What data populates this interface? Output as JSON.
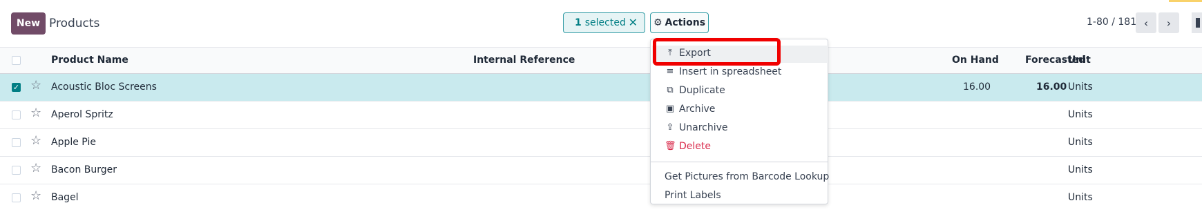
{
  "control_panel": {
    "new_label": "New",
    "title": "Products",
    "selected_count": "1",
    "selected_label": "selected",
    "clear_icon": "close-icon",
    "actions_label": "Actions",
    "actions_icon": "gear-icon",
    "pager_text": "1-80 / 181",
    "prev_icon": "chevron-left-icon",
    "next_icon": "chevron-right-icon"
  },
  "table": {
    "headers": {
      "name": "Product Name",
      "ref": "Internal Reference",
      "on_hand": "On Hand",
      "forecasted": "Forecasted",
      "unit": "Unit"
    },
    "rows": [
      {
        "name": "Acoustic Bloc Screens",
        "on_hand": "16.00",
        "forecasted": "16.00",
        "unit": "Units",
        "selected": true
      },
      {
        "name": "Aperol Spritz",
        "on_hand": "",
        "forecasted": "",
        "unit": "Units",
        "selected": false
      },
      {
        "name": "Apple Pie",
        "on_hand": "",
        "forecasted": "",
        "unit": "Units",
        "selected": false
      },
      {
        "name": "Bacon Burger",
        "on_hand": "",
        "forecasted": "",
        "unit": "Units",
        "selected": false
      },
      {
        "name": "Bagel",
        "on_hand": "",
        "forecasted": "",
        "unit": "Units",
        "selected": false
      }
    ]
  },
  "actions_menu": {
    "items": [
      {
        "label": "Export",
        "icon": "upload-icon"
      },
      {
        "label": "Insert in spreadsheet",
        "icon": "list-icon"
      },
      {
        "label": "Duplicate",
        "icon": "copy-icon"
      },
      {
        "label": "Archive",
        "icon": "archive-icon"
      },
      {
        "label": "Unarchive",
        "icon": "unarchive-icon"
      },
      {
        "label": "Delete",
        "icon": "trash-icon"
      }
    ],
    "extra": [
      {
        "label": "Get Pictures from Barcode Lookup"
      },
      {
        "label": "Print Labels"
      }
    ]
  },
  "colors": {
    "brand": "#714B67",
    "accent": "#017e84",
    "selected_row": "#c9eaee",
    "danger": "#d9294a",
    "highlight": "#f00000"
  }
}
